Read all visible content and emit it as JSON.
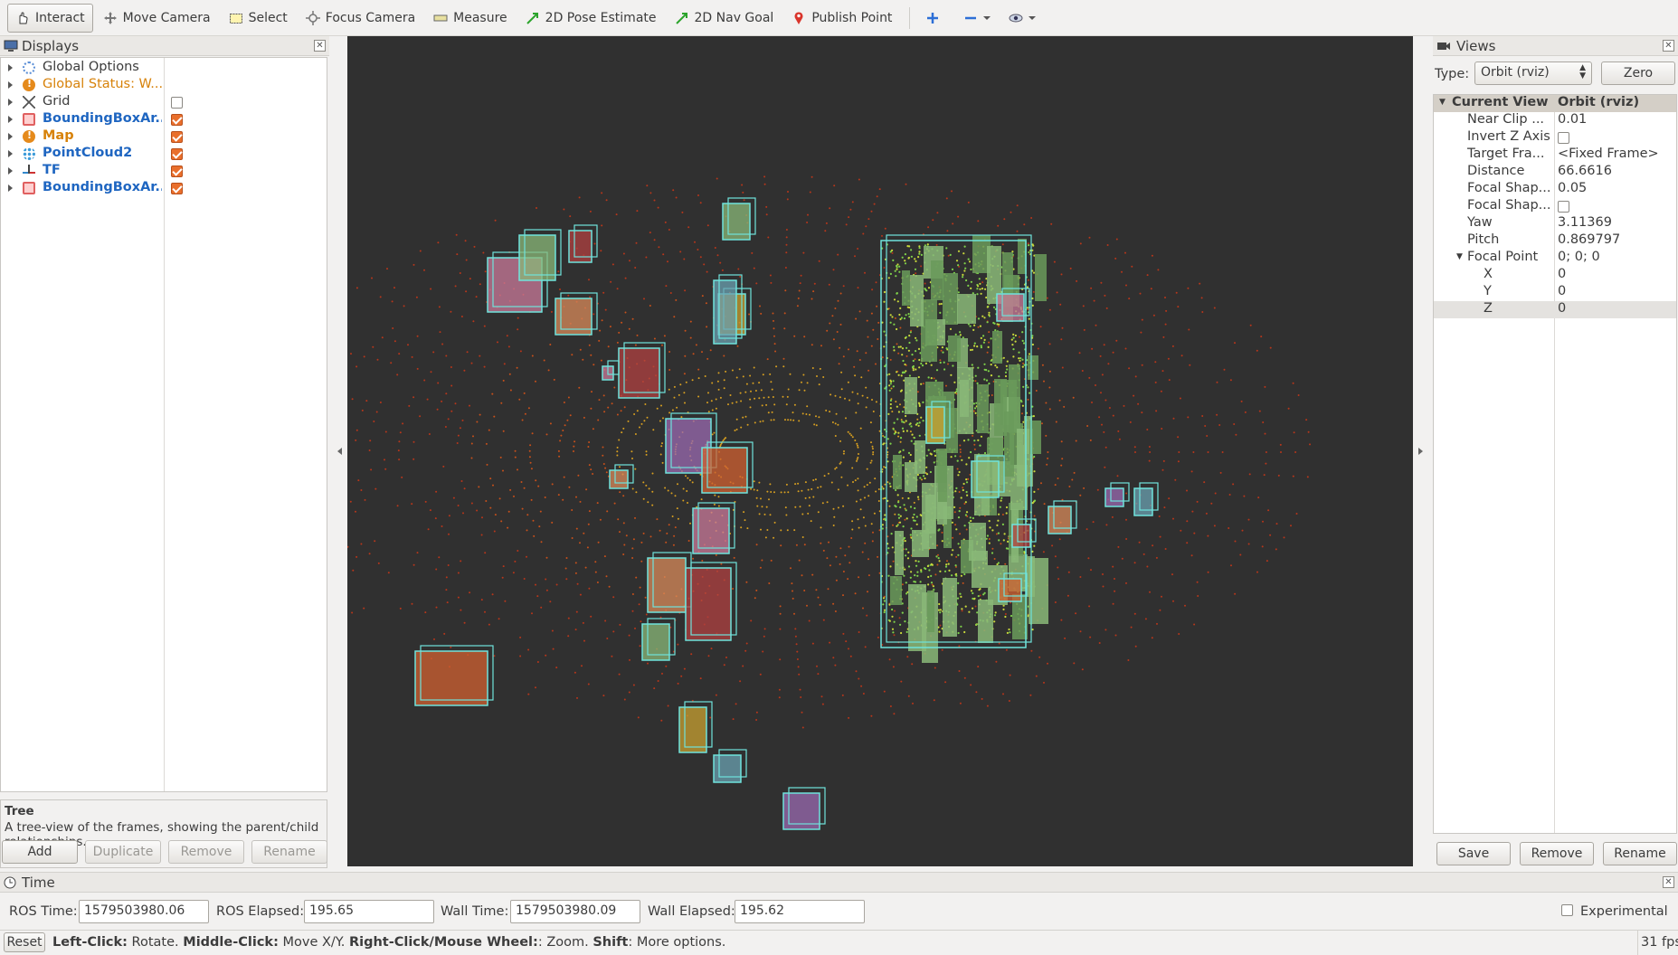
{
  "toolbar": {
    "tools": [
      {
        "label": "Interact",
        "icon": "hand-pointer-icon",
        "active": true
      },
      {
        "label": "Move Camera",
        "icon": "move-camera-icon"
      },
      {
        "label": "Select",
        "icon": "select-rectangle-icon"
      },
      {
        "label": "Focus Camera",
        "icon": "focus-camera-icon"
      },
      {
        "label": "Measure",
        "icon": "ruler-icon"
      },
      {
        "label": "2D Pose Estimate",
        "icon": "green-arrow-icon"
      },
      {
        "label": "2D Nav Goal",
        "icon": "green-arrow-icon"
      },
      {
        "label": "Publish Point",
        "icon": "map-pin-icon"
      }
    ]
  },
  "displays": {
    "title": "Displays",
    "items": [
      {
        "label": "Global Options",
        "icon": "gear-icon",
        "style": "normal",
        "checkbox": null
      },
      {
        "label": "Global Status: W...",
        "icon": "warning-icon",
        "style": "orange",
        "checkbox": null
      },
      {
        "label": "Grid",
        "icon": "grid-icon",
        "style": "normal",
        "checkbox": false
      },
      {
        "label": "BoundingBoxAr...",
        "icon": "bounding-box-icon",
        "style": "blue",
        "checkbox": true
      },
      {
        "label": "Map",
        "icon": "warning-icon",
        "style": "orange-bold",
        "checkbox": true
      },
      {
        "label": "PointCloud2",
        "icon": "pointcloud-icon",
        "style": "blue",
        "checkbox": true
      },
      {
        "label": "TF",
        "icon": "tf-axes-icon",
        "style": "blue",
        "checkbox": true
      },
      {
        "label": "BoundingBoxAr...",
        "icon": "bounding-box-icon",
        "style": "blue",
        "checkbox": true
      }
    ],
    "description_title": "Tree",
    "description_text": "A tree-view of the frames, showing the parent/child relationships.",
    "buttons": {
      "add": "Add",
      "duplicate": "Duplicate",
      "remove": "Remove",
      "rename": "Rename"
    }
  },
  "views": {
    "title": "Views",
    "type_label": "Type:",
    "type_value": "Orbit (rviz)",
    "zero_label": "Zero",
    "header_key": "Current View",
    "header_value": "Orbit (rviz)",
    "properties": [
      {
        "key": "Near Clip ...",
        "value": "0.01",
        "indent": 1
      },
      {
        "key": "Invert Z Axis",
        "value": "",
        "checkbox": false,
        "indent": 1
      },
      {
        "key": "Target Fra...",
        "value": "<Fixed Frame>",
        "indent": 1
      },
      {
        "key": "Distance",
        "value": "66.6616",
        "indent": 1
      },
      {
        "key": "Focal Shap...",
        "value": "0.05",
        "indent": 1
      },
      {
        "key": "Focal Shap...",
        "value": "",
        "checkbox": false,
        "indent": 1
      },
      {
        "key": "Yaw",
        "value": "3.11369",
        "indent": 1
      },
      {
        "key": "Pitch",
        "value": "0.869797",
        "indent": 1
      },
      {
        "key": "Focal Point",
        "value": "0; 0; 0",
        "indent": 1,
        "expanded": true
      },
      {
        "key": "X",
        "value": "0",
        "indent": 2
      },
      {
        "key": "Y",
        "value": "0",
        "indent": 2
      },
      {
        "key": "Z",
        "value": "0",
        "indent": 2,
        "selected": true
      }
    ],
    "buttons": {
      "save": "Save",
      "remove": "Remove",
      "rename": "Rename"
    }
  },
  "time": {
    "title": "Time",
    "ros_time_label": "ROS Time:",
    "ros_time": "1579503980.06",
    "ros_elapsed_label": "ROS Elapsed:",
    "ros_elapsed": "195.65",
    "wall_time_label": "Wall Time:",
    "wall_time": "1579503980.09",
    "wall_elapsed_label": "Wall Elapsed:",
    "wall_elapsed": "195.62",
    "experimental_label": "Experimental"
  },
  "status": {
    "reset_label": "Reset",
    "hint_left_key": "Left-Click:",
    "hint_left": " Rotate. ",
    "hint_middle_key": "Middle-Click:",
    "hint_middle": " Move X/Y. ",
    "hint_right_key": "Right-Click/Mouse Wheel:",
    "hint_right": ": Zoom. ",
    "hint_shift_key": "Shift",
    "hint_shift": ": More options.",
    "fps": "31 fps"
  },
  "colors": {
    "background_3d": "#303030",
    "box_outline": "#6fe3dc",
    "checkbox_on": "#e96f2c",
    "link_blue": "#1f66c1",
    "warning_orange": "#d7820a"
  }
}
